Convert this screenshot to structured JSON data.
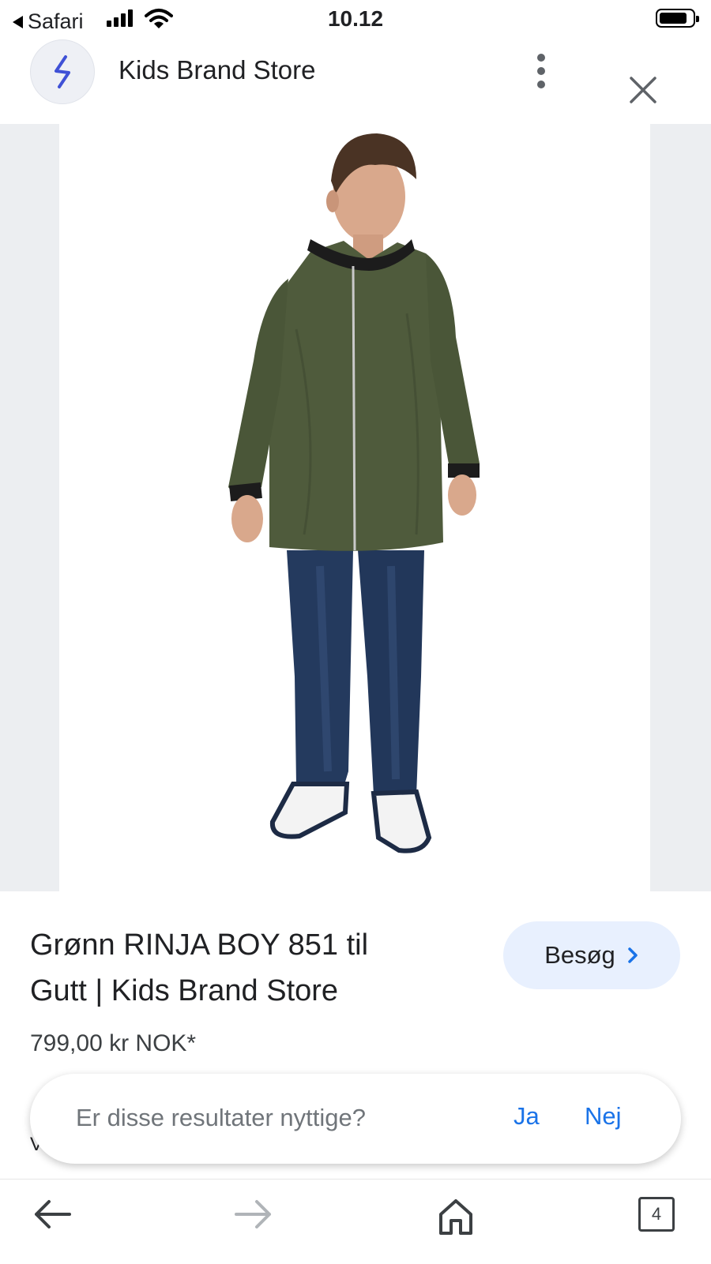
{
  "status_bar": {
    "back_app": "Safari",
    "time": "10.12"
  },
  "site": {
    "name": "Kids Brand Store",
    "logo_icon": "lightning-bolt-icon",
    "menu_icon": "more-vert-icon",
    "close_icon": "close-icon"
  },
  "product": {
    "title_line1": "Grønn RINJA BOY 851 til",
    "title_line2": "Gutt | Kids Brand Store",
    "price": "799,00 kr NOK*",
    "visit_label": "Besøg",
    "image_description": "Boy wearing olive green long bomber jacket, blue jeans and sneakers"
  },
  "feedback": {
    "question": "Er disse resultater nyttige?",
    "yes": "Ja",
    "no": "Nej"
  },
  "peek_text": "V",
  "toolbar": {
    "back_icon": "arrow-left-icon",
    "forward_icon": "arrow-right-icon",
    "home_icon": "home-icon",
    "tab_count": "4"
  },
  "colors": {
    "accent": "#1a73e8",
    "visit_bg": "#e8f0fe",
    "jacket": "#4f5b3c",
    "jeans": "#243a5e",
    "image_band": "#eceef1"
  }
}
